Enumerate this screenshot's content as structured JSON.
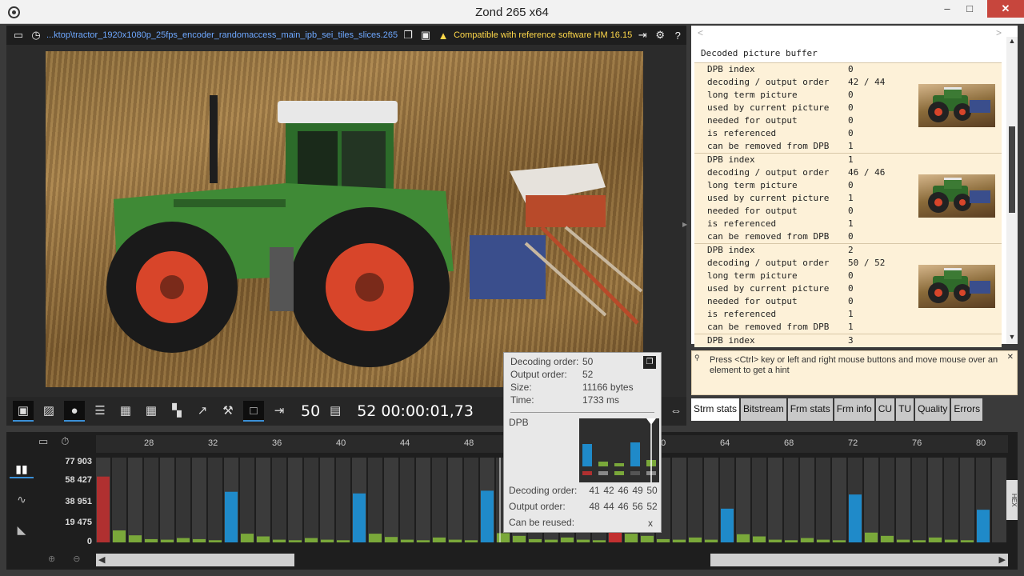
{
  "window": {
    "title": "Zond 265 x64",
    "min": "–",
    "max": "□",
    "close": "✕"
  },
  "toolbar": {
    "file_path": "...ktop\\tractor_1920x1080p_25fps_encoder_randomaccess_main_ipb_sei_tiles_slices.265",
    "compat_text": "Compatible with reference software HM 16.15"
  },
  "playback": {
    "decode_num": "50",
    "output_num": "52",
    "timecode": "00:00:01,73"
  },
  "dpb": {
    "title": "Decoded picture buffer",
    "nav_left": "<",
    "nav_right": ">",
    "entries": [
      {
        "index": "0",
        "order": "42 / 44",
        "long_term": "0",
        "used_current": "0",
        "needed_output": "0",
        "is_referenced": "0",
        "can_remove": "1"
      },
      {
        "index": "1",
        "order": "46 / 46",
        "long_term": "0",
        "used_current": "1",
        "needed_output": "0",
        "is_referenced": "1",
        "can_remove": "0"
      },
      {
        "index": "2",
        "order": "50 / 52",
        "long_term": "0",
        "used_current": "0",
        "needed_output": "0",
        "is_referenced": "1",
        "can_remove": "1"
      }
    ],
    "last_index_label": "DPB index",
    "last_index_value": "3",
    "labels": {
      "index": "DPB index",
      "order": "decoding / output order",
      "long_term": "long term picture",
      "used_current": "used by current picture",
      "needed_output": "needed for output",
      "is_referenced": "is referenced",
      "can_remove": "can be removed from DPB"
    }
  },
  "hint": {
    "text": "Press <Ctrl> key or left and right mouse buttons and move mouse over an element to get a hint"
  },
  "tabs": [
    "Strm stats",
    "Bitstream",
    "Frm stats",
    "Frm info",
    "CU",
    "TU",
    "Quality",
    "Errors"
  ],
  "hex_label": "HEX",
  "timeline": {
    "ticks": [
      "28",
      "32",
      "36",
      "40",
      "44",
      "48",
      "60",
      "64",
      "68",
      "72",
      "76",
      "80"
    ],
    "y_labels": [
      "77 903",
      "58 427",
      "38 951",
      "19 475",
      "0"
    ]
  },
  "tooltip": {
    "decoding_order_label": "Decoding order:",
    "decoding_order": "50",
    "output_order_label": "Output order:",
    "output_order": "52",
    "size_label": "Size:",
    "size": "11166 bytes",
    "time_label": "Time:",
    "time": "1733 ms",
    "dpb_label": "DPB",
    "grid_decoding_label": "Decoding order:",
    "grid_decoding": [
      "41",
      "42",
      "46",
      "49",
      "50"
    ],
    "grid_output_label": "Output order:",
    "grid_output": [
      "48",
      "44",
      "46",
      "56",
      "52"
    ],
    "reuse_label": "Can be reused:",
    "reuse_value": "x"
  },
  "chart_data": {
    "type": "bar",
    "ylim": [
      0,
      77903
    ],
    "colors": {
      "I": "#b03030",
      "P": "#1f8ac9",
      "B": "#7aa83a",
      "cur": "#c23030"
    },
    "bars": [
      {
        "x": 0,
        "v": 60500,
        "t": "I"
      },
      {
        "x": 1,
        "v": 11000,
        "t": "B"
      },
      {
        "x": 2,
        "v": 6500,
        "t": "B"
      },
      {
        "x": 3,
        "v": 3000,
        "t": "B"
      },
      {
        "x": 4,
        "v": 2500,
        "t": "B"
      },
      {
        "x": 5,
        "v": 4000,
        "t": "B"
      },
      {
        "x": 6,
        "v": 3000,
        "t": "B"
      },
      {
        "x": 7,
        "v": 2000,
        "t": "B"
      },
      {
        "x": 8,
        "v": 46500,
        "t": "P"
      },
      {
        "x": 9,
        "v": 8000,
        "t": "B"
      },
      {
        "x": 10,
        "v": 5500,
        "t": "B"
      },
      {
        "x": 11,
        "v": 2500,
        "t": "B"
      },
      {
        "x": 12,
        "v": 2000,
        "t": "B"
      },
      {
        "x": 13,
        "v": 4000,
        "t": "B"
      },
      {
        "x": 14,
        "v": 2500,
        "t": "B"
      },
      {
        "x": 15,
        "v": 2000,
        "t": "B"
      },
      {
        "x": 16,
        "v": 45000,
        "t": "P"
      },
      {
        "x": 17,
        "v": 8000,
        "t": "B"
      },
      {
        "x": 18,
        "v": 5000,
        "t": "B"
      },
      {
        "x": 19,
        "v": 2500,
        "t": "B"
      },
      {
        "x": 20,
        "v": 2000,
        "t": "B"
      },
      {
        "x": 21,
        "v": 4500,
        "t": "B"
      },
      {
        "x": 22,
        "v": 2500,
        "t": "B"
      },
      {
        "x": 23,
        "v": 2000,
        "t": "B"
      },
      {
        "x": 24,
        "v": 47500,
        "t": "P"
      },
      {
        "x": 25,
        "v": 8500,
        "t": "B"
      },
      {
        "x": 26,
        "v": 6000,
        "t": "B"
      },
      {
        "x": 27,
        "v": 3000,
        "t": "B"
      },
      {
        "x": 28,
        "v": 2500,
        "t": "B"
      },
      {
        "x": 29,
        "v": 4500,
        "t": "B"
      },
      {
        "x": 30,
        "v": 2500,
        "t": "B"
      },
      {
        "x": 31,
        "v": 2000,
        "t": "B"
      },
      {
        "x": 32,
        "v": 11000,
        "t": "cur"
      },
      {
        "x": 33,
        "v": 8000,
        "t": "B"
      },
      {
        "x": 34,
        "v": 6000,
        "t": "B"
      },
      {
        "x": 35,
        "v": 3000,
        "t": "B"
      },
      {
        "x": 36,
        "v": 2500,
        "t": "B"
      },
      {
        "x": 37,
        "v": 4500,
        "t": "B"
      },
      {
        "x": 38,
        "v": 2500,
        "t": "B"
      },
      {
        "x": 39,
        "v": 31000,
        "t": "P"
      },
      {
        "x": 40,
        "v": 7500,
        "t": "B"
      },
      {
        "x": 41,
        "v": 5500,
        "t": "B"
      },
      {
        "x": 42,
        "v": 2500,
        "t": "B"
      },
      {
        "x": 43,
        "v": 2000,
        "t": "B"
      },
      {
        "x": 44,
        "v": 4000,
        "t": "B"
      },
      {
        "x": 45,
        "v": 2500,
        "t": "B"
      },
      {
        "x": 46,
        "v": 2000,
        "t": "B"
      },
      {
        "x": 47,
        "v": 44000,
        "t": "P"
      },
      {
        "x": 48,
        "v": 9000,
        "t": "B"
      },
      {
        "x": 49,
        "v": 6000,
        "t": "B"
      },
      {
        "x": 50,
        "v": 2500,
        "t": "B"
      },
      {
        "x": 51,
        "v": 2000,
        "t": "B"
      },
      {
        "x": 52,
        "v": 4500,
        "t": "B"
      },
      {
        "x": 53,
        "v": 2500,
        "t": "B"
      },
      {
        "x": 54,
        "v": 2000,
        "t": "B"
      },
      {
        "x": 55,
        "v": 30000,
        "t": "P"
      }
    ]
  }
}
